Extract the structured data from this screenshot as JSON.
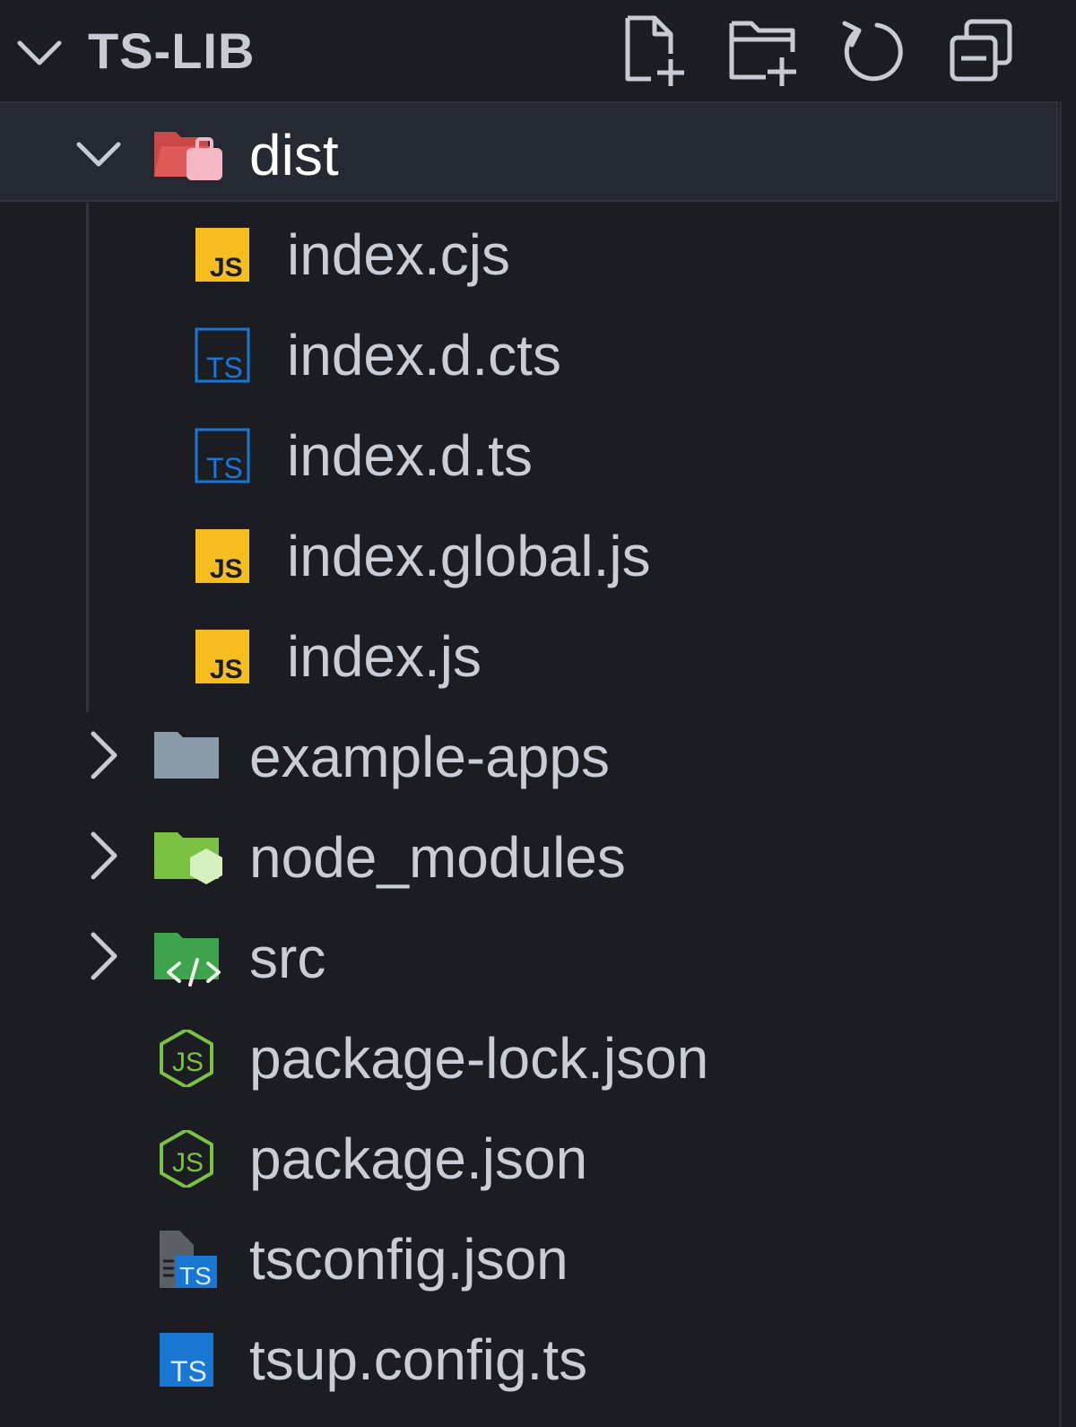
{
  "header": {
    "title": "TS-LIB",
    "actions": [
      "new-file-icon",
      "new-folder-icon",
      "refresh-icon",
      "collapse-all-icon"
    ]
  },
  "tree": {
    "dist": "dist",
    "dist_children": [
      "index.cjs",
      "index.d.cts",
      "index.d.ts",
      "index.global.js",
      "index.js"
    ],
    "example_apps": "example-apps",
    "node_modules": "node_modules",
    "src": "src",
    "package_lock": "package-lock.json",
    "package_json": "package.json",
    "tsconfig": "tsconfig.json",
    "tsup_config": "tsup.config.ts"
  },
  "icons": {
    "js_badge": "JS",
    "ts_badge": "TS"
  },
  "colors": {
    "background": "#1b1d22",
    "selected_row": "#252932",
    "js_yellow": "#f5bd1f",
    "ts_blue": "#1976d2",
    "folder_gray": "#8a9aa6",
    "node_green": "#7cc242",
    "src_green": "#3fa34d",
    "dist_red": "#e05a5a"
  }
}
